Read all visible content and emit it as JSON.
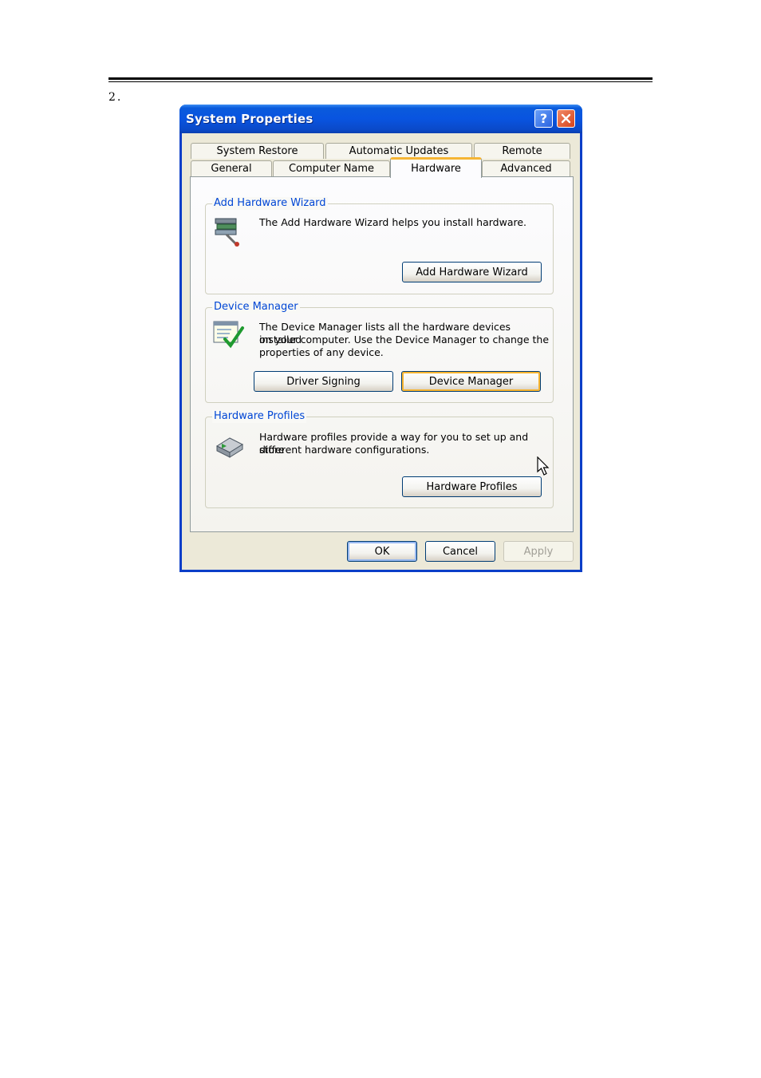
{
  "document": {
    "step_number": "2."
  },
  "window": {
    "title": "System Properties",
    "help_button": "?",
    "tabs_row1": [
      "System Restore",
      "Automatic Updates",
      "Remote"
    ],
    "tabs_row2": [
      "General",
      "Computer Name",
      "Hardware",
      "Advanced"
    ],
    "active_tab": "Hardware"
  },
  "add_hardware_wizard": {
    "legend": "Add Hardware Wizard",
    "description": "The Add Hardware Wizard helps you install hardware.",
    "button": "Add Hardware Wizard"
  },
  "device_manager": {
    "legend": "Device Manager",
    "description_lines": [
      "The Device Manager lists all the hardware devices installed",
      "on your computer. Use the Device Manager to change the",
      "properties of any device."
    ],
    "driver_signing_button": "Driver Signing",
    "device_manager_button": "Device Manager"
  },
  "hardware_profiles": {
    "legend": "Hardware Profiles",
    "description_lines": [
      "Hardware profiles provide a way for you to set up and store",
      "different hardware configurations."
    ],
    "button": "Hardware Profiles"
  },
  "footer": {
    "ok": "OK",
    "cancel": "Cancel",
    "apply": "Apply"
  },
  "colors": {
    "titlebar": "#0a5bdc",
    "legend_text": "#0046d5",
    "active_tab_highlight": "#f5b534",
    "dialog_background": "#ece9d8"
  }
}
